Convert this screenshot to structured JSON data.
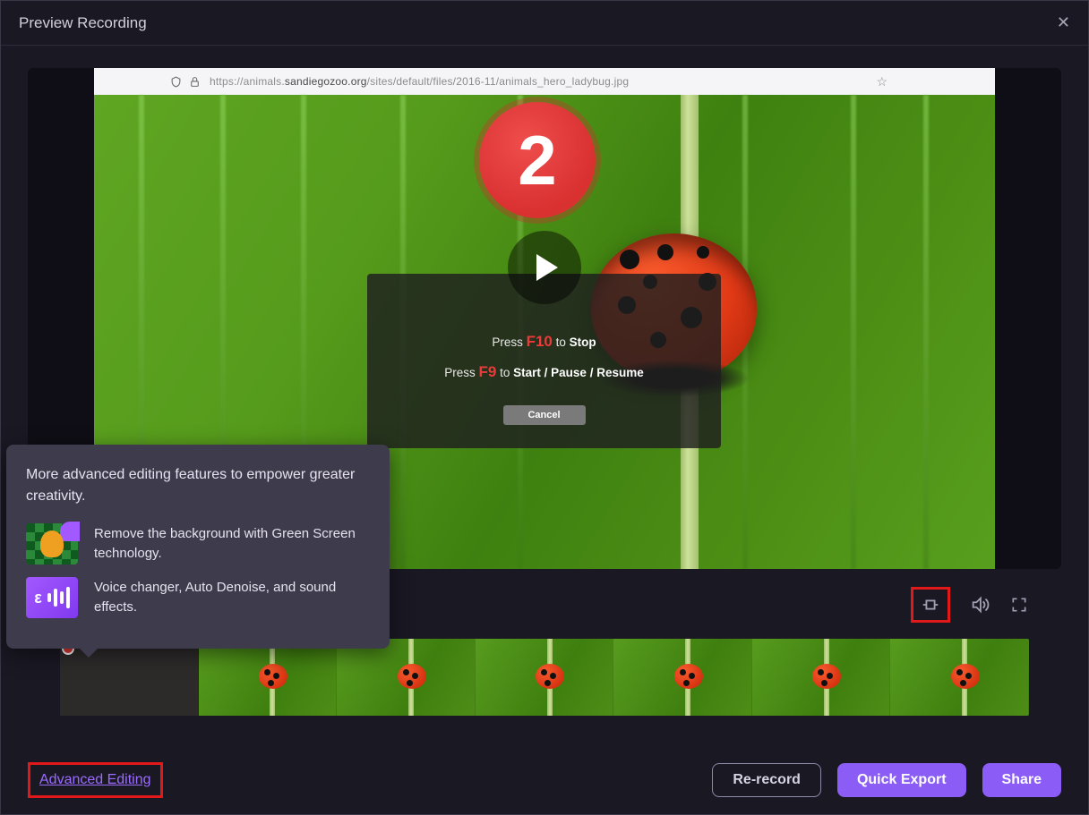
{
  "window": {
    "title": "Preview Recording"
  },
  "browser": {
    "url_prefix": "https://animals.",
    "url_domain": "sandiegozoo.org",
    "url_path": "/sites/default/files/2016-11/animals_hero_ladybug.jpg"
  },
  "countdown": {
    "value": "2"
  },
  "overlay": {
    "line1_press": "Press ",
    "line1_key": "F10",
    "line1_to": " to ",
    "line1_action": "Stop",
    "line2_press": "Press ",
    "line2_key": "F9",
    "line2_to": "  to ",
    "line2_action": "Start / Pause",
    "line2_tail": " / Resume",
    "cancel": "Cancel"
  },
  "tooltip": {
    "heading": "More advanced editing features to empower greater creativity.",
    "feature1": "Remove the background with Green Screen technology.",
    "feature2": "Voice changer, Auto Denoise, and sound effects."
  },
  "footer": {
    "advanced_link": "Advanced Editing",
    "rerecord": "Re-record",
    "quick_export": "Quick Export",
    "share": "Share"
  },
  "colors": {
    "accent": "#8b5cf6",
    "danger": "#e21919"
  }
}
